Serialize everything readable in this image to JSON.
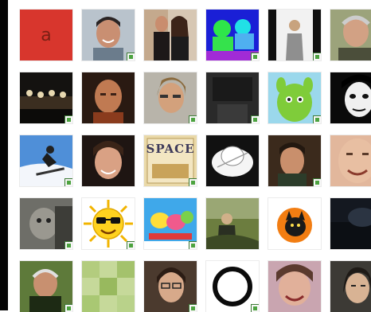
{
  "tile_a_glyph": "a",
  "space_text": "SPACE",
  "gallery": {
    "rows": [
      [
        "red-avatar-icon",
        "smiling-man-photo",
        "couple-photo",
        "neon-figures-photo",
        "person-standing-photo",
        "smiling-older-man-photo"
      ],
      [
        "band-on-stage-photo",
        "bald-man-portrait",
        "woman-selfie-photo",
        "dark-window-photo",
        "green-cartoon-character",
        "cartoon-woman-face"
      ],
      [
        "snowboarder-photo",
        "young-man-portrait",
        "space-logo-image",
        "white-hat-drawing",
        "man-indoors-photo",
        "smiling-man-closeup"
      ],
      [
        "gray-animal-photo",
        "sunglasses-sun-icon",
        "colorful-text-art",
        "hiker-photo",
        "black-cat-orange-icon",
        "dark-abstract-photo"
      ],
      [
        "older-man-outdoors-photo",
        "green-checker-pattern",
        "woman-with-glasses-photo",
        "black-ring-logo",
        "laughing-woman-photo",
        "woman-portrait-photo"
      ]
    ]
  }
}
